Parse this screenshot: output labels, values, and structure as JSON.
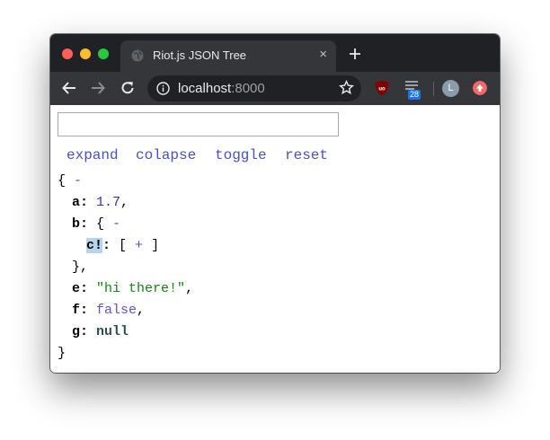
{
  "browser": {
    "tab_title": "Riot.js JSON Tree",
    "tab_close": "×",
    "url_host": "localhost",
    "url_port": ":8000",
    "badge_count": "28",
    "avatar_letter": "L"
  },
  "page": {
    "search": {
      "value": "",
      "placeholder": ""
    },
    "actions": [
      "expand",
      "colapse",
      "toggle",
      "reset"
    ],
    "tree": {
      "open_brace": "{",
      "collapse_toggle": "-",
      "expand_toggle": "+",
      "close_brace": "}",
      "entries": {
        "a": {
          "key": "a",
          "value": "1.7"
        },
        "b": {
          "key": "b"
        },
        "c": {
          "key": "c!"
        },
        "e": {
          "key": "e",
          "value": "\"hi there!\""
        },
        "f": {
          "key": "f",
          "value": "false"
        },
        "g": {
          "key": "g",
          "value": "null"
        }
      }
    }
  },
  "colors": {
    "link": "#4a4fc4",
    "number": "#2f2fd1",
    "string": "#198219",
    "boolean": "#6b4fd1",
    "selection": "#b5d4f0"
  }
}
